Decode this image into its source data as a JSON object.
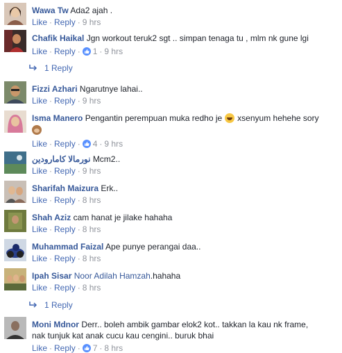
{
  "comments": [
    {
      "name": "Wawa Tw",
      "text": "Ada2 ajah .",
      "like": "Like",
      "reply": "Reply",
      "time": "9 hrs"
    },
    {
      "name": "Chafik Haikal",
      "text": "Jgn workout teruk2 sgt .. simpan tenaga tu , mlm nk gune lgi",
      "like": "Like",
      "reply": "Reply",
      "reactions": "1",
      "time": "9 hrs",
      "replies": "1 Reply"
    },
    {
      "name": "Fizzi Azhari",
      "text": "Ngarutnye lahai..",
      "like": "Like",
      "reply": "Reply",
      "time": "9 hrs"
    },
    {
      "name": "Isma Manero",
      "text_a": "Pengantin perempuan muka redho je",
      "text_b": "xsenyum hehehe sory",
      "like": "Like",
      "reply": "Reply",
      "reactions": "4",
      "time": "9 hrs"
    },
    {
      "name": "نورمالا كامارودين",
      "text": "Mcm2..",
      "like": "Like",
      "reply": "Reply",
      "time": "9 hrs"
    },
    {
      "name": "Sharifah Maizura",
      "text": "Erk..",
      "like": "Like",
      "reply": "Reply",
      "time": "8 hrs"
    },
    {
      "name": "Shah Aziz",
      "text": "cam hanat je jilake hahaha",
      "like": "Like",
      "reply": "Reply",
      "time": "8 hrs"
    },
    {
      "name": "Muhammad Faizal",
      "text": "Ape punye perangai daa..",
      "like": "Like",
      "reply": "Reply",
      "time": "8 hrs"
    },
    {
      "name": "Ipah Sisar",
      "tag": "Noor Adilah Hamzah",
      "text": ".hahaha",
      "like": "Like",
      "reply": "Reply",
      "time": "8 hrs",
      "replies": "1 Reply"
    },
    {
      "name": "Moni Mdnor",
      "text": "Derr.. boleh ambik gambar elok2 kot.. takkan la kau nk frame, nak tunjuk kat anak cucu kau cengini.. buruk bhai",
      "like": "Like",
      "reply": "Reply",
      "reactions": "7",
      "time": "8 hrs"
    }
  ],
  "colors": {
    "name": "#365899",
    "link": "#4267b2",
    "meta": "#90949c",
    "like_icon": "#5890ff"
  }
}
